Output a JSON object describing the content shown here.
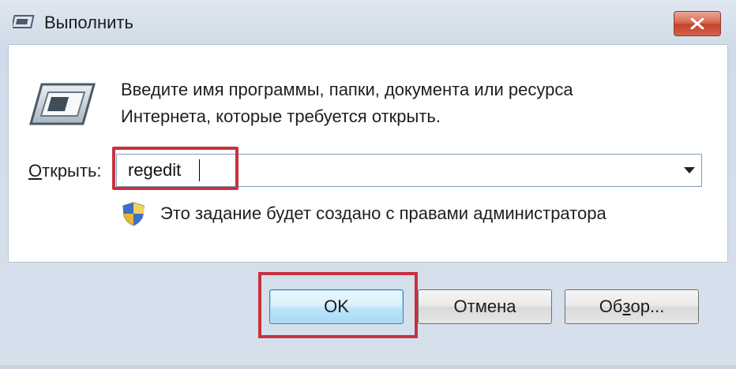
{
  "window": {
    "title": "Выполнить",
    "icons": {
      "title": "run-icon",
      "close": "close-icon"
    }
  },
  "dialog": {
    "icon": "run-program-icon",
    "prompt": "Введите имя программы, папки, документа или ресурса\nИнтернета, которые требуется открыть.",
    "open_label_prefix": "О",
    "open_label_rest": "ткрыть:",
    "open_value": "regedit",
    "admin_icon": "uac-shield-icon",
    "admin_note": "Это задание будет создано с правами администратора"
  },
  "buttons": {
    "ok": "OK",
    "cancel": "Отмена",
    "browse_prefix": "Об",
    "browse_hotkey": "з",
    "browse_rest": "ор..."
  },
  "colors": {
    "highlight": "#c8313f",
    "close": "#c2432a",
    "ok_button": "#bee6fd"
  }
}
